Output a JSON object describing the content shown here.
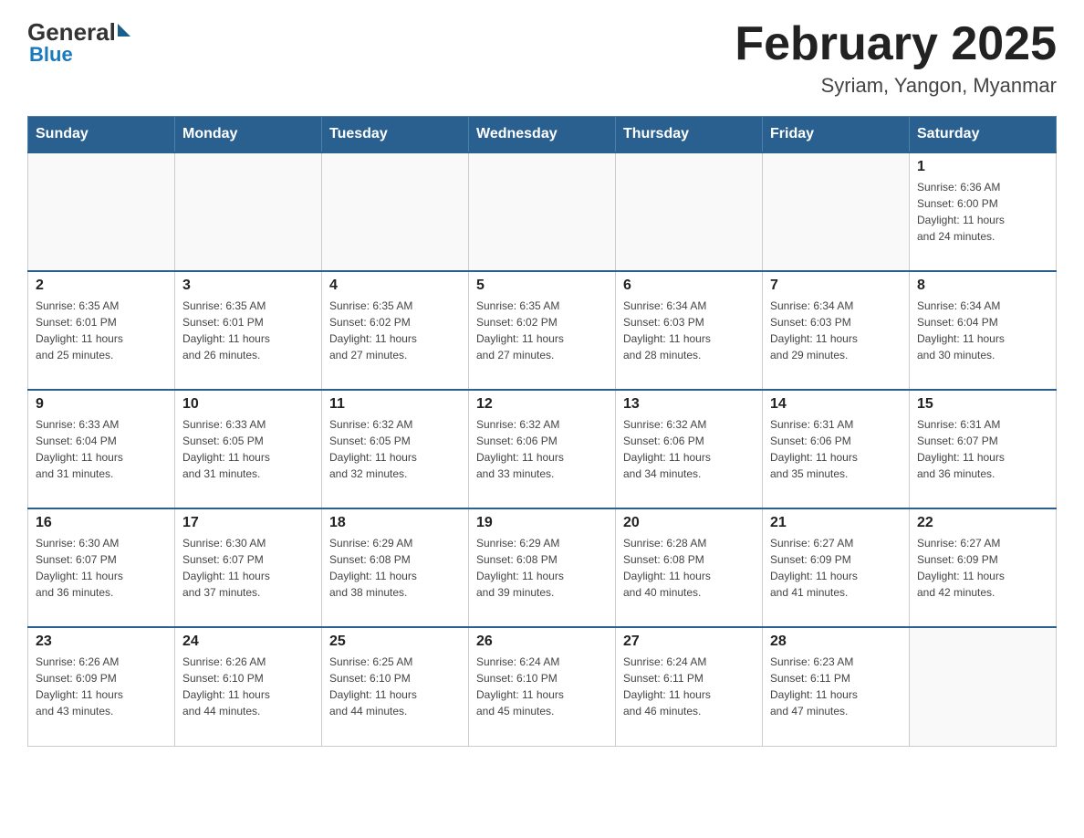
{
  "header": {
    "logo": {
      "general": "General",
      "blue": "Blue"
    },
    "title": "February 2025",
    "subtitle": "Syriam, Yangon, Myanmar"
  },
  "weekdays": [
    "Sunday",
    "Monday",
    "Tuesday",
    "Wednesday",
    "Thursday",
    "Friday",
    "Saturday"
  ],
  "weeks": [
    [
      {
        "day": "",
        "info": ""
      },
      {
        "day": "",
        "info": ""
      },
      {
        "day": "",
        "info": ""
      },
      {
        "day": "",
        "info": ""
      },
      {
        "day": "",
        "info": ""
      },
      {
        "day": "",
        "info": ""
      },
      {
        "day": "1",
        "info": "Sunrise: 6:36 AM\nSunset: 6:00 PM\nDaylight: 11 hours\nand 24 minutes."
      }
    ],
    [
      {
        "day": "2",
        "info": "Sunrise: 6:35 AM\nSunset: 6:01 PM\nDaylight: 11 hours\nand 25 minutes."
      },
      {
        "day": "3",
        "info": "Sunrise: 6:35 AM\nSunset: 6:01 PM\nDaylight: 11 hours\nand 26 minutes."
      },
      {
        "day": "4",
        "info": "Sunrise: 6:35 AM\nSunset: 6:02 PM\nDaylight: 11 hours\nand 27 minutes."
      },
      {
        "day": "5",
        "info": "Sunrise: 6:35 AM\nSunset: 6:02 PM\nDaylight: 11 hours\nand 27 minutes."
      },
      {
        "day": "6",
        "info": "Sunrise: 6:34 AM\nSunset: 6:03 PM\nDaylight: 11 hours\nand 28 minutes."
      },
      {
        "day": "7",
        "info": "Sunrise: 6:34 AM\nSunset: 6:03 PM\nDaylight: 11 hours\nand 29 minutes."
      },
      {
        "day": "8",
        "info": "Sunrise: 6:34 AM\nSunset: 6:04 PM\nDaylight: 11 hours\nand 30 minutes."
      }
    ],
    [
      {
        "day": "9",
        "info": "Sunrise: 6:33 AM\nSunset: 6:04 PM\nDaylight: 11 hours\nand 31 minutes."
      },
      {
        "day": "10",
        "info": "Sunrise: 6:33 AM\nSunset: 6:05 PM\nDaylight: 11 hours\nand 31 minutes."
      },
      {
        "day": "11",
        "info": "Sunrise: 6:32 AM\nSunset: 6:05 PM\nDaylight: 11 hours\nand 32 minutes."
      },
      {
        "day": "12",
        "info": "Sunrise: 6:32 AM\nSunset: 6:06 PM\nDaylight: 11 hours\nand 33 minutes."
      },
      {
        "day": "13",
        "info": "Sunrise: 6:32 AM\nSunset: 6:06 PM\nDaylight: 11 hours\nand 34 minutes."
      },
      {
        "day": "14",
        "info": "Sunrise: 6:31 AM\nSunset: 6:06 PM\nDaylight: 11 hours\nand 35 minutes."
      },
      {
        "day": "15",
        "info": "Sunrise: 6:31 AM\nSunset: 6:07 PM\nDaylight: 11 hours\nand 36 minutes."
      }
    ],
    [
      {
        "day": "16",
        "info": "Sunrise: 6:30 AM\nSunset: 6:07 PM\nDaylight: 11 hours\nand 36 minutes."
      },
      {
        "day": "17",
        "info": "Sunrise: 6:30 AM\nSunset: 6:07 PM\nDaylight: 11 hours\nand 37 minutes."
      },
      {
        "day": "18",
        "info": "Sunrise: 6:29 AM\nSunset: 6:08 PM\nDaylight: 11 hours\nand 38 minutes."
      },
      {
        "day": "19",
        "info": "Sunrise: 6:29 AM\nSunset: 6:08 PM\nDaylight: 11 hours\nand 39 minutes."
      },
      {
        "day": "20",
        "info": "Sunrise: 6:28 AM\nSunset: 6:08 PM\nDaylight: 11 hours\nand 40 minutes."
      },
      {
        "day": "21",
        "info": "Sunrise: 6:27 AM\nSunset: 6:09 PM\nDaylight: 11 hours\nand 41 minutes."
      },
      {
        "day": "22",
        "info": "Sunrise: 6:27 AM\nSunset: 6:09 PM\nDaylight: 11 hours\nand 42 minutes."
      }
    ],
    [
      {
        "day": "23",
        "info": "Sunrise: 6:26 AM\nSunset: 6:09 PM\nDaylight: 11 hours\nand 43 minutes."
      },
      {
        "day": "24",
        "info": "Sunrise: 6:26 AM\nSunset: 6:10 PM\nDaylight: 11 hours\nand 44 minutes."
      },
      {
        "day": "25",
        "info": "Sunrise: 6:25 AM\nSunset: 6:10 PM\nDaylight: 11 hours\nand 44 minutes."
      },
      {
        "day": "26",
        "info": "Sunrise: 6:24 AM\nSunset: 6:10 PM\nDaylight: 11 hours\nand 45 minutes."
      },
      {
        "day": "27",
        "info": "Sunrise: 6:24 AM\nSunset: 6:11 PM\nDaylight: 11 hours\nand 46 minutes."
      },
      {
        "day": "28",
        "info": "Sunrise: 6:23 AM\nSunset: 6:11 PM\nDaylight: 11 hours\nand 47 minutes."
      },
      {
        "day": "",
        "info": ""
      }
    ]
  ]
}
